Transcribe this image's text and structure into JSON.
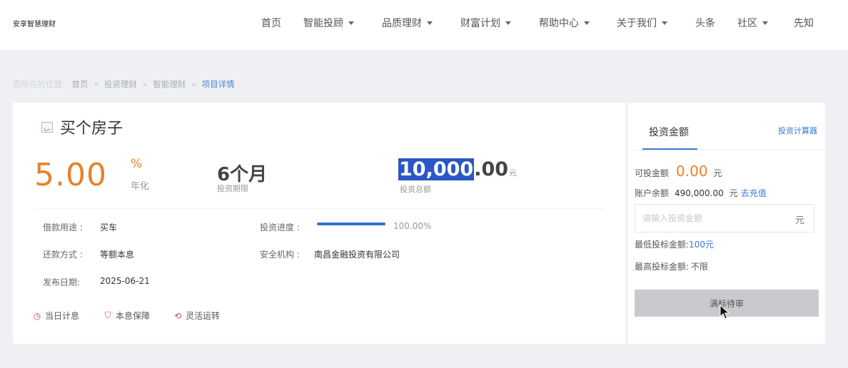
{
  "header": {
    "logo": "安享智慧理财",
    "nav": [
      {
        "label": "首页",
        "dropdown": false
      },
      {
        "label": "智能投顾",
        "dropdown": true
      },
      {
        "label": "品质理财",
        "dropdown": true
      },
      {
        "label": "财富计划",
        "dropdown": true
      },
      {
        "label": "帮助中心",
        "dropdown": true
      },
      {
        "label": "关于我们",
        "dropdown": true
      },
      {
        "label": "头条",
        "dropdown": false
      },
      {
        "label": "社区",
        "dropdown": true
      },
      {
        "label": "先知",
        "dropdown": false
      }
    ]
  },
  "breadcrumb": {
    "prefix": "您所在的位置:",
    "items": [
      "首页",
      "投资理财",
      "智能理财"
    ],
    "current": "项目详情",
    "separator": "»"
  },
  "project": {
    "title": "买个房子",
    "rate": "5.00",
    "rate_unit": "%",
    "rate_label": "年化",
    "period": "6个月",
    "period_label": "投资期限",
    "total_highlight": "10,000",
    "total_rest": ".00",
    "total_unit": "元",
    "total_label": "投资总额",
    "info": {
      "purpose_label": "借款用途 :",
      "purpose_value": "买车",
      "repay_label": "还款方式 :",
      "repay_value": "等额本息",
      "date_label": "发布日期:",
      "date_value": "2025-06-21",
      "progress_label": "投资进度 :",
      "progress_value": "100.00%",
      "progress_fraction": 1.0,
      "agency_label": "安全机构 :",
      "agency_value": "南昌金融投资有限公司"
    },
    "features": [
      {
        "icon": "clock-icon",
        "glyph": "◷",
        "label": "当日计息"
      },
      {
        "icon": "shield-icon",
        "glyph": "⛉",
        "label": "本息保障"
      },
      {
        "icon": "refresh-icon",
        "glyph": "⟲",
        "label": "灵活运转"
      }
    ]
  },
  "invest_panel": {
    "tab": "投资金额",
    "calculator_link": "投资计算器",
    "available_label": "可投金额",
    "available_value": "0.00",
    "available_unit": "元",
    "balance_label": "账户余额",
    "balance_value": "490,000.00",
    "balance_unit": "元",
    "recharge_link": "去充值",
    "input_placeholder": "请输入投资金额",
    "input_unit": "元",
    "min_label": "最低投标金额:",
    "min_value": "100元",
    "max_label": "最高投标金额:",
    "max_value": "不限",
    "submit_label": "满标待审"
  },
  "colors": {
    "accent_orange": "#e8812c",
    "link_blue": "#3a78d6",
    "highlight_blue": "#2a57c6",
    "icon_red": "#d24545"
  }
}
